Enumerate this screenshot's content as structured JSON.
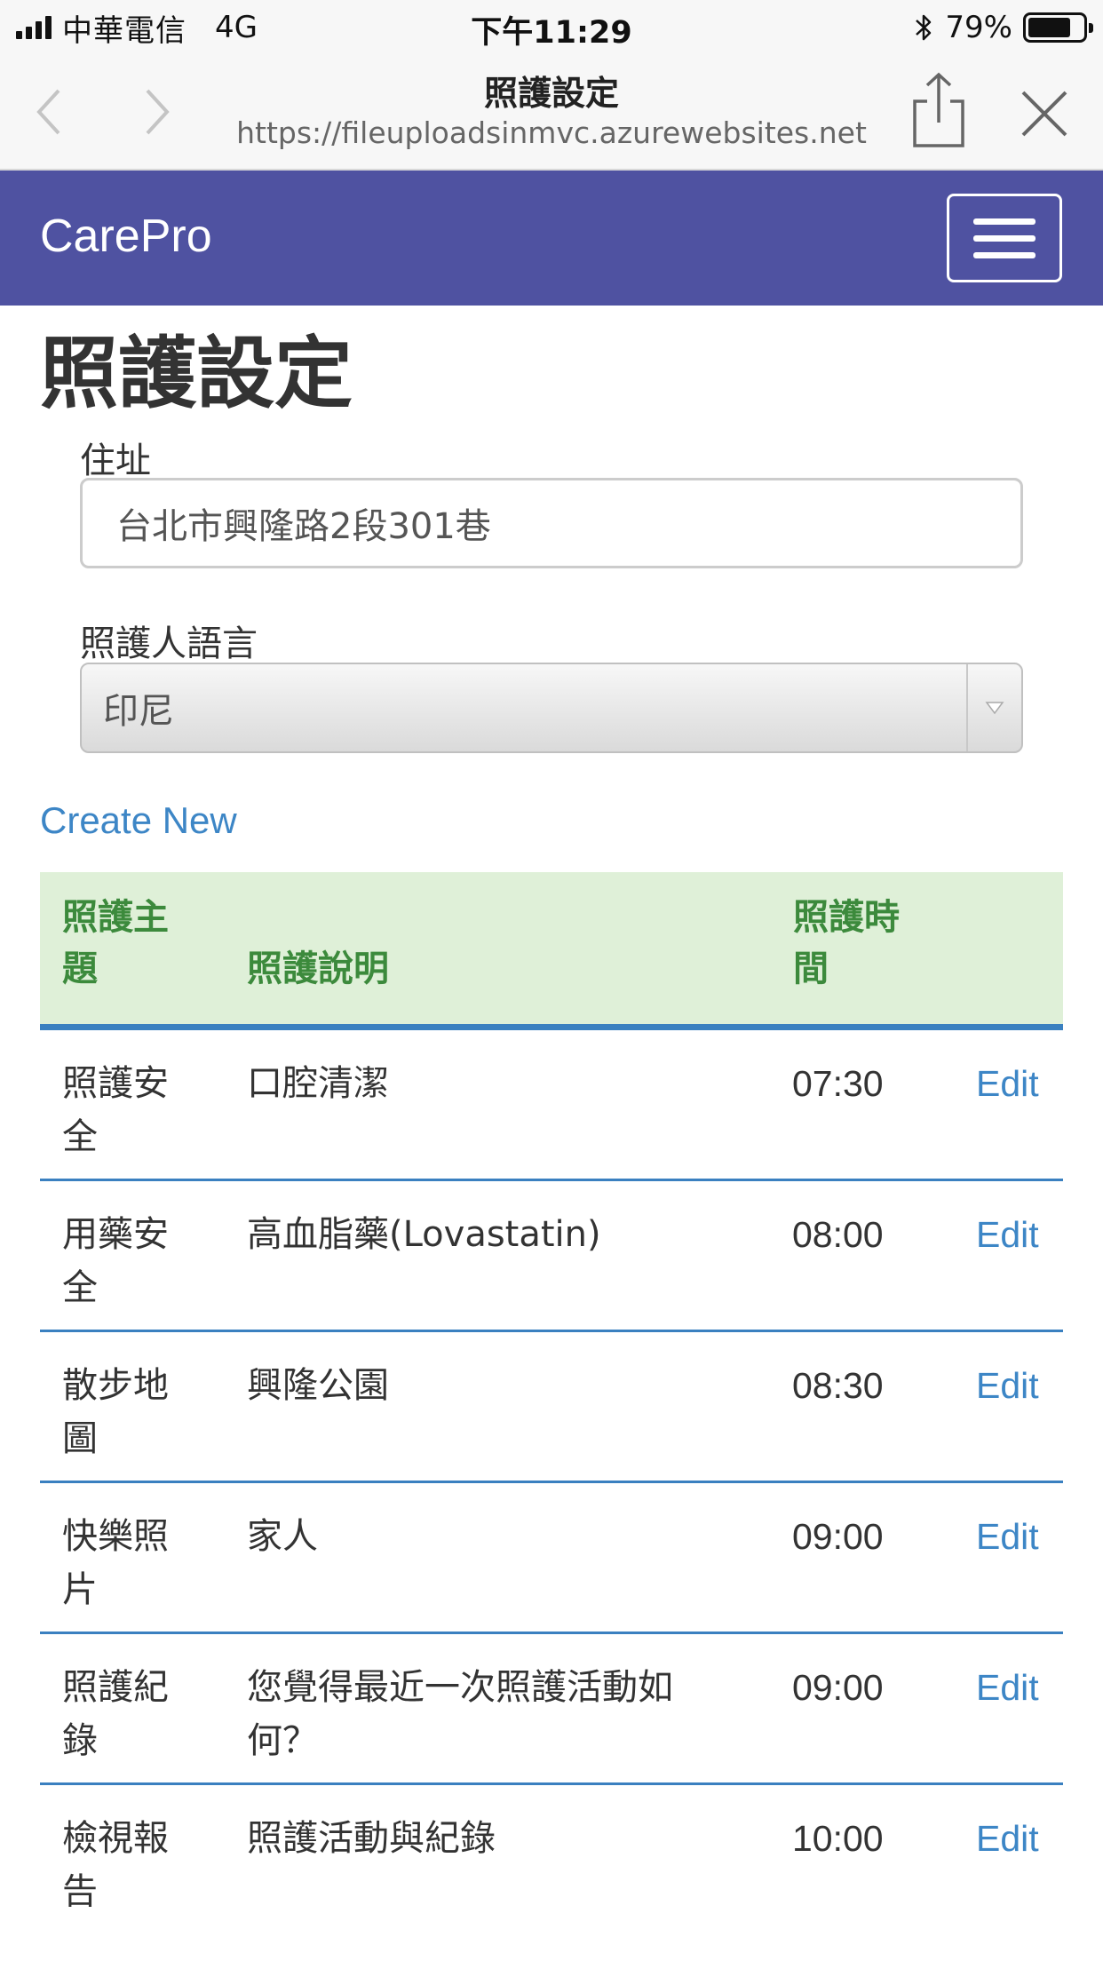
{
  "status_bar": {
    "carrier": "中華電信",
    "network": "4G",
    "time": "下午11:29",
    "battery": "79%",
    "battery_level": 0.79
  },
  "browser": {
    "title": "照護設定",
    "url": "https://fileuploadsinmvc.azurewebsites.net"
  },
  "navbar": {
    "brand": "CarePro"
  },
  "page": {
    "heading": "照護設定",
    "address_label": "住址",
    "address_value": "台北市興隆路2段301巷",
    "language_label": "照護人語言",
    "language_value": "印尼",
    "create_new": "Create New"
  },
  "table": {
    "headers": {
      "topic": "照護主題",
      "description": "照護說明",
      "time": "照護時間"
    },
    "rows": [
      {
        "topic": "照護安全",
        "description": "口腔清潔",
        "time": "07:30",
        "action": "Edit"
      },
      {
        "topic": "用藥安全",
        "description": "高血脂藥(Lovastatin)",
        "time": "08:00",
        "action": "Edit"
      },
      {
        "topic": "散步地圖",
        "description": "興隆公園",
        "time": "08:30",
        "action": "Edit"
      },
      {
        "topic": "快樂照片",
        "description": "家人",
        "time": "09:00",
        "action": "Edit"
      },
      {
        "topic": "照護紀錄",
        "description": "您覺得最近一次照護活動如何？",
        "time": "09:00",
        "action": "Edit"
      },
      {
        "topic": "檢視報告",
        "description": "照護活動與紀錄",
        "time": "10:00",
        "action": "Edit"
      }
    ]
  }
}
